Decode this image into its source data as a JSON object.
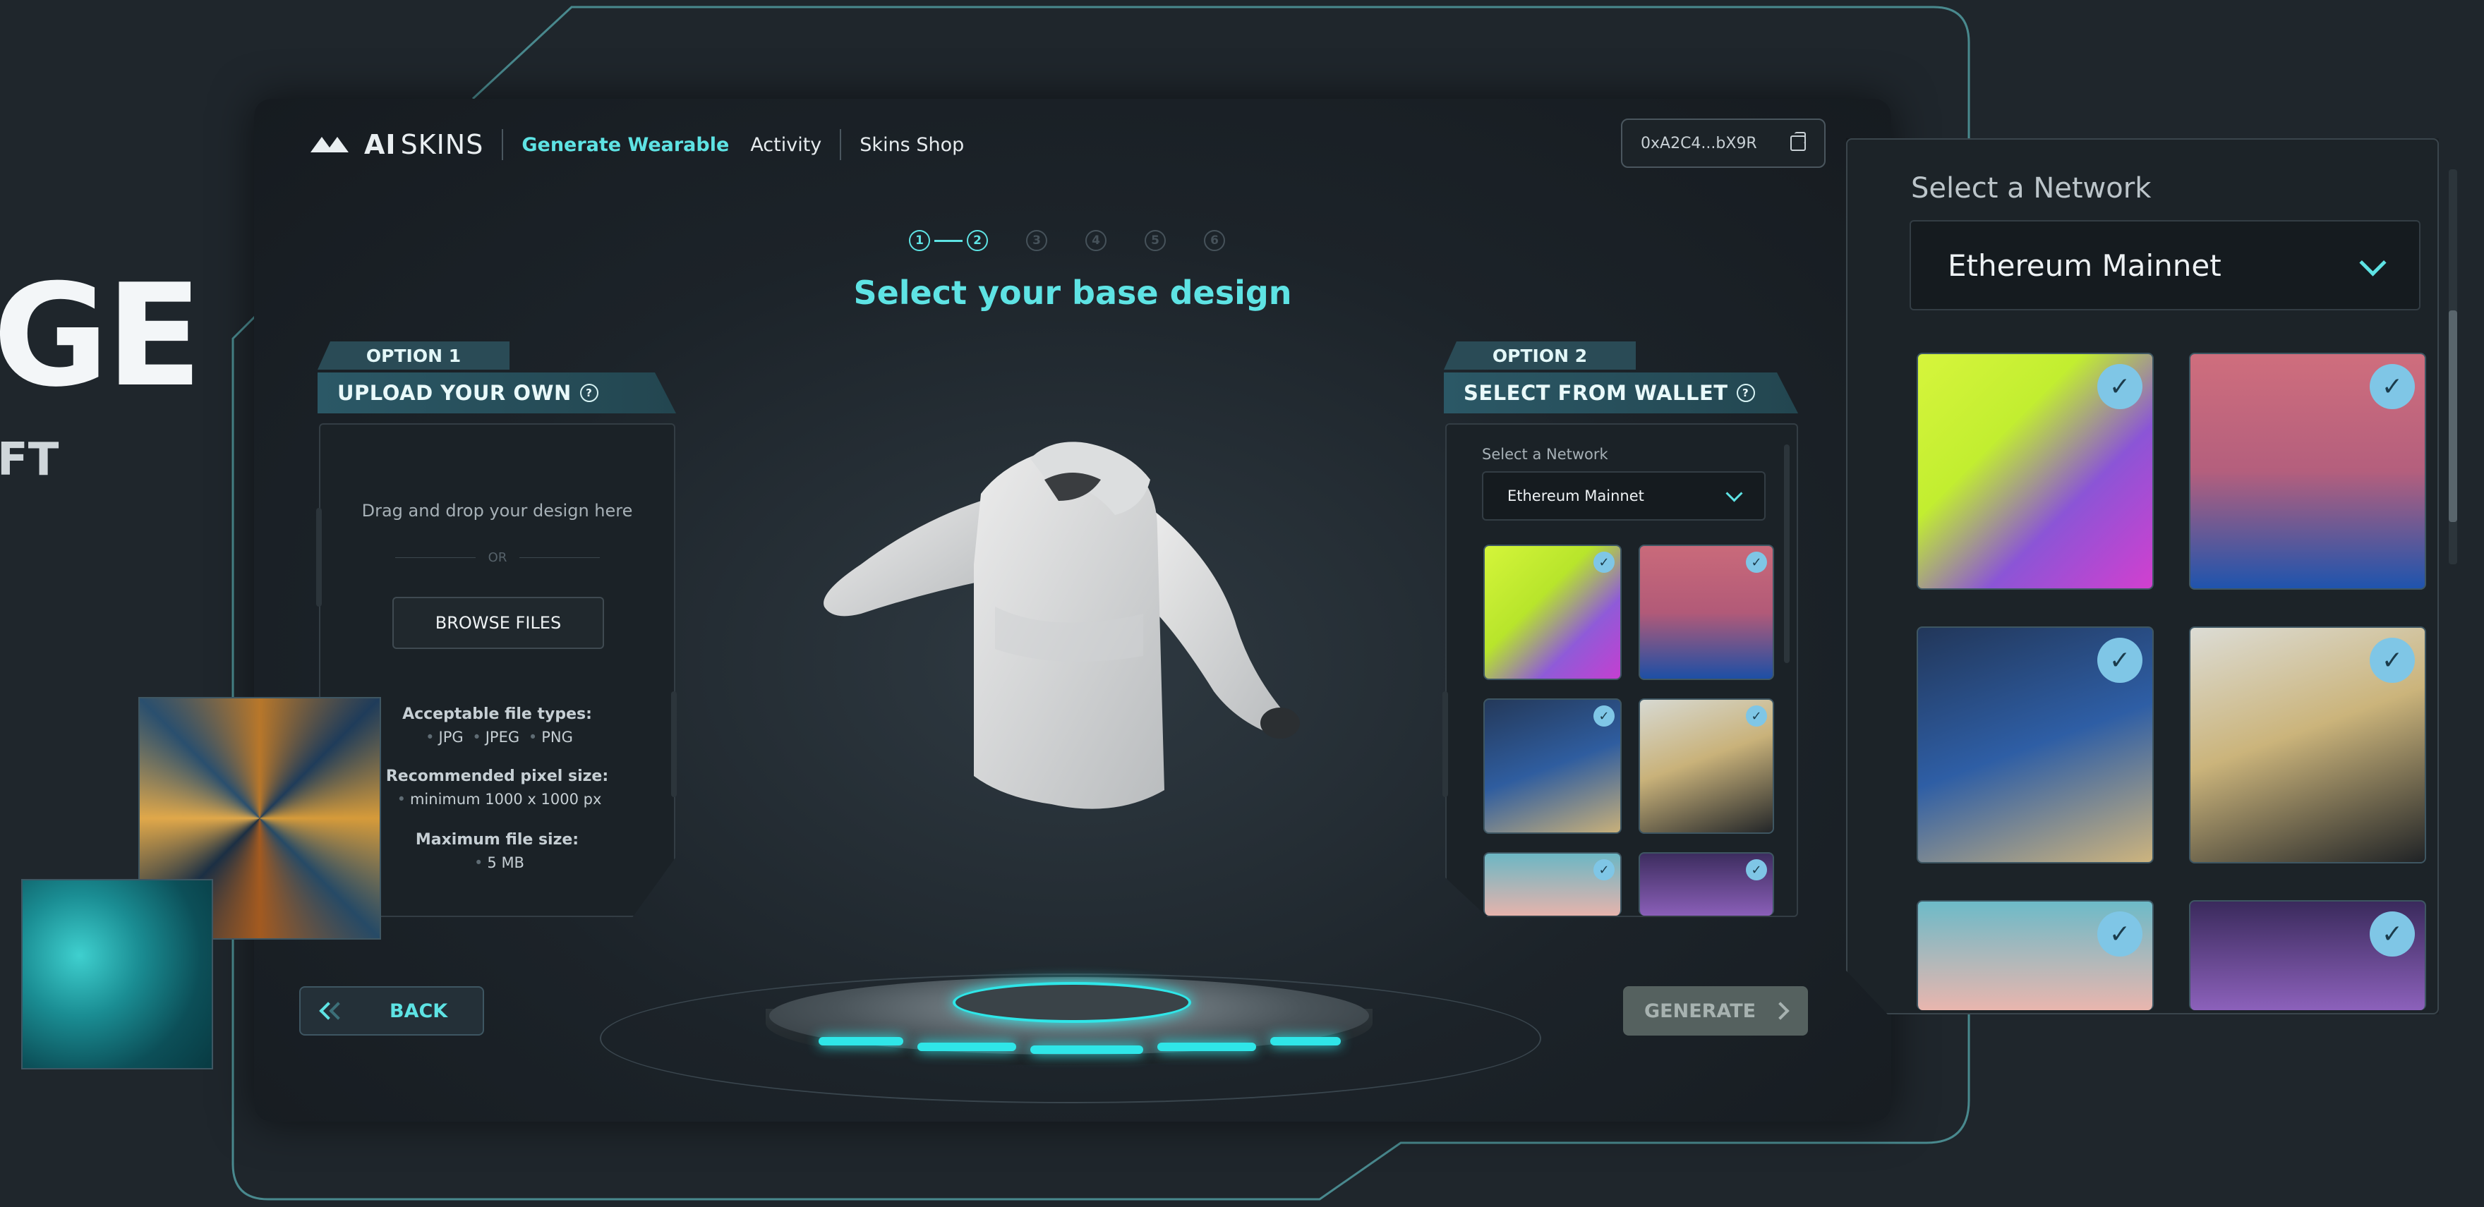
{
  "hero": {
    "big_text": "GE",
    "small_text": "FT"
  },
  "header": {
    "brand_ai": "AI",
    "brand_skins": "SKINS",
    "nav": [
      {
        "label": "Generate Wearable",
        "active": true
      },
      {
        "label": "Activity",
        "active": false
      },
      {
        "label": "Skins Shop",
        "active": false
      }
    ],
    "wallet_address": "0xA2C4...bX9R",
    "copy_icon": "copy-icon"
  },
  "stepper": {
    "steps": [
      "1",
      "2",
      "3",
      "4",
      "5",
      "6"
    ],
    "current": 2
  },
  "title": "Select your base design",
  "option1": {
    "tab": "OPTION 1",
    "heading": "UPLOAD YOUR OWN",
    "drag_text": "Drag and drop your design here",
    "or_text": "OR",
    "browse_label": "BROWSE FILES",
    "file_types_label": "Acceptable file types:",
    "file_types": [
      "JPG",
      "JPEG",
      "PNG"
    ],
    "pixel_label": "Recommended pixel size:",
    "pixel_value": "minimum 1000 x 1000 px",
    "max_label": "Maximum file size:",
    "max_value": "5 MB"
  },
  "option2": {
    "tab": "OPTION 2",
    "heading": "SELECT FROM WALLET",
    "network_label": "Select a Network",
    "network_value": "Ethereum Mainnet"
  },
  "zoom": {
    "network_label": "Select a Network",
    "network_value": "Ethereum Mainnet"
  },
  "buttons": {
    "back": "BACK",
    "generate": "GENERATE"
  },
  "colors": {
    "accent": "#5ee3e4",
    "panel": "#1b2227",
    "background": "#1f262c"
  }
}
